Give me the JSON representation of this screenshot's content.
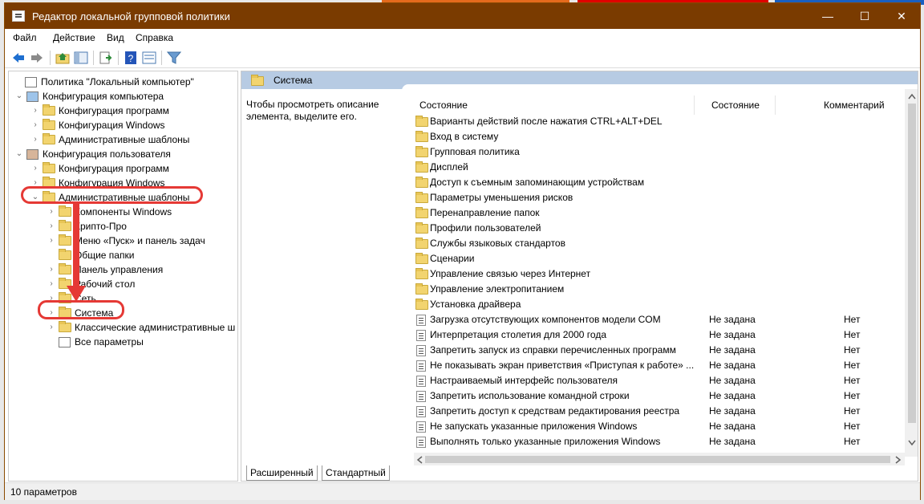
{
  "window": {
    "title": "Редактор локальной групповой политики"
  },
  "titlebar_buttons": {
    "minimize": "—",
    "maximize": "☐",
    "close": "✕"
  },
  "menu": [
    "Файл",
    "Действие",
    "Вид",
    "Справка"
  ],
  "tree": [
    {
      "label": "Политика \"Локальный компьютер\"",
      "icon": "policy-icon"
    },
    {
      "label": "Конфигурация компьютера",
      "icon": "computer-icon"
    },
    {
      "label": "Конфигурация программ",
      "icon": "folder-icon"
    },
    {
      "label": "Конфигурация Windows",
      "icon": "folder-icon"
    },
    {
      "label": "Административные шаблоны",
      "icon": "folder-icon"
    },
    {
      "label": "Конфигурация пользователя",
      "icon": "user-icon"
    },
    {
      "label": "Конфигурация программ",
      "icon": "folder-icon"
    },
    {
      "label": "Конфигурация Windows",
      "icon": "folder-icon"
    },
    {
      "label": "Административные шаблоны",
      "icon": "folder-icon"
    },
    {
      "label": "Компоненты Windows",
      "icon": "folder-icon"
    },
    {
      "label": "Крипто-Про",
      "icon": "folder-icon"
    },
    {
      "label": "Меню «Пуск» и панель задач",
      "icon": "folder-icon"
    },
    {
      "label": "Общие папки",
      "icon": "folder-icon"
    },
    {
      "label": "Панель управления",
      "icon": "folder-icon"
    },
    {
      "label": "Рабочий стол",
      "icon": "folder-icon"
    },
    {
      "label": "Сеть",
      "icon": "folder-icon"
    },
    {
      "label": "Система",
      "icon": "folder-icon"
    },
    {
      "label": "Классические административные ш",
      "icon": "folder-icon"
    },
    {
      "label": "Все параметры",
      "icon": "settings-icon"
    }
  ],
  "right": {
    "header": "Система",
    "description": "Чтобы просмотреть описание элемента, выделите его.",
    "columns": {
      "name": "Состояние",
      "state": "Состояние",
      "comment": "Комментарий"
    },
    "folders": [
      "Варианты действий после нажатия CTRL+ALT+DEL",
      "Вход в систему",
      "Групповая политика",
      "Дисплей",
      "Доступ к съемным запоминающим устройствам",
      "Параметры уменьшения рисков",
      "Перенаправление папок",
      "Профили пользователей",
      "Службы языковых стандартов",
      "Сценарии",
      "Управление связью через Интернет",
      "Управление электропитанием",
      "Установка драйвера"
    ],
    "policies": [
      {
        "name": "Загрузка отсутствующих компонентов модели COM",
        "state": "Не задана",
        "comment": "Нет"
      },
      {
        "name": "Интерпретация столетия для 2000 года",
        "state": "Не задана",
        "comment": "Нет"
      },
      {
        "name": "Запретить запуск из справки перечисленных программ",
        "state": "Не задана",
        "comment": "Нет"
      },
      {
        "name": "Не показывать экран приветствия «Приступая к работе» ...",
        "state": "Не задана",
        "comment": "Нет"
      },
      {
        "name": "Настраиваемый интерфейс пользователя",
        "state": "Не задана",
        "comment": "Нет"
      },
      {
        "name": "Запретить использование командной строки",
        "state": "Не задана",
        "comment": "Нет"
      },
      {
        "name": "Запретить доступ к средствам редактирования реестра",
        "state": "Не задана",
        "comment": "Нет"
      },
      {
        "name": "Не запускать указанные приложения Windows",
        "state": "Не задана",
        "comment": "Нет"
      },
      {
        "name": "Выполнять только указанные приложения Windows",
        "state": "Не задана",
        "comment": "Нет"
      }
    ],
    "tabs": [
      "Расширенный",
      "Стандартный"
    ]
  },
  "status": "10 параметров",
  "colors": {
    "titlebar": "#7a3b00",
    "highlight": "#e53935",
    "header": "#b7cbe3"
  }
}
